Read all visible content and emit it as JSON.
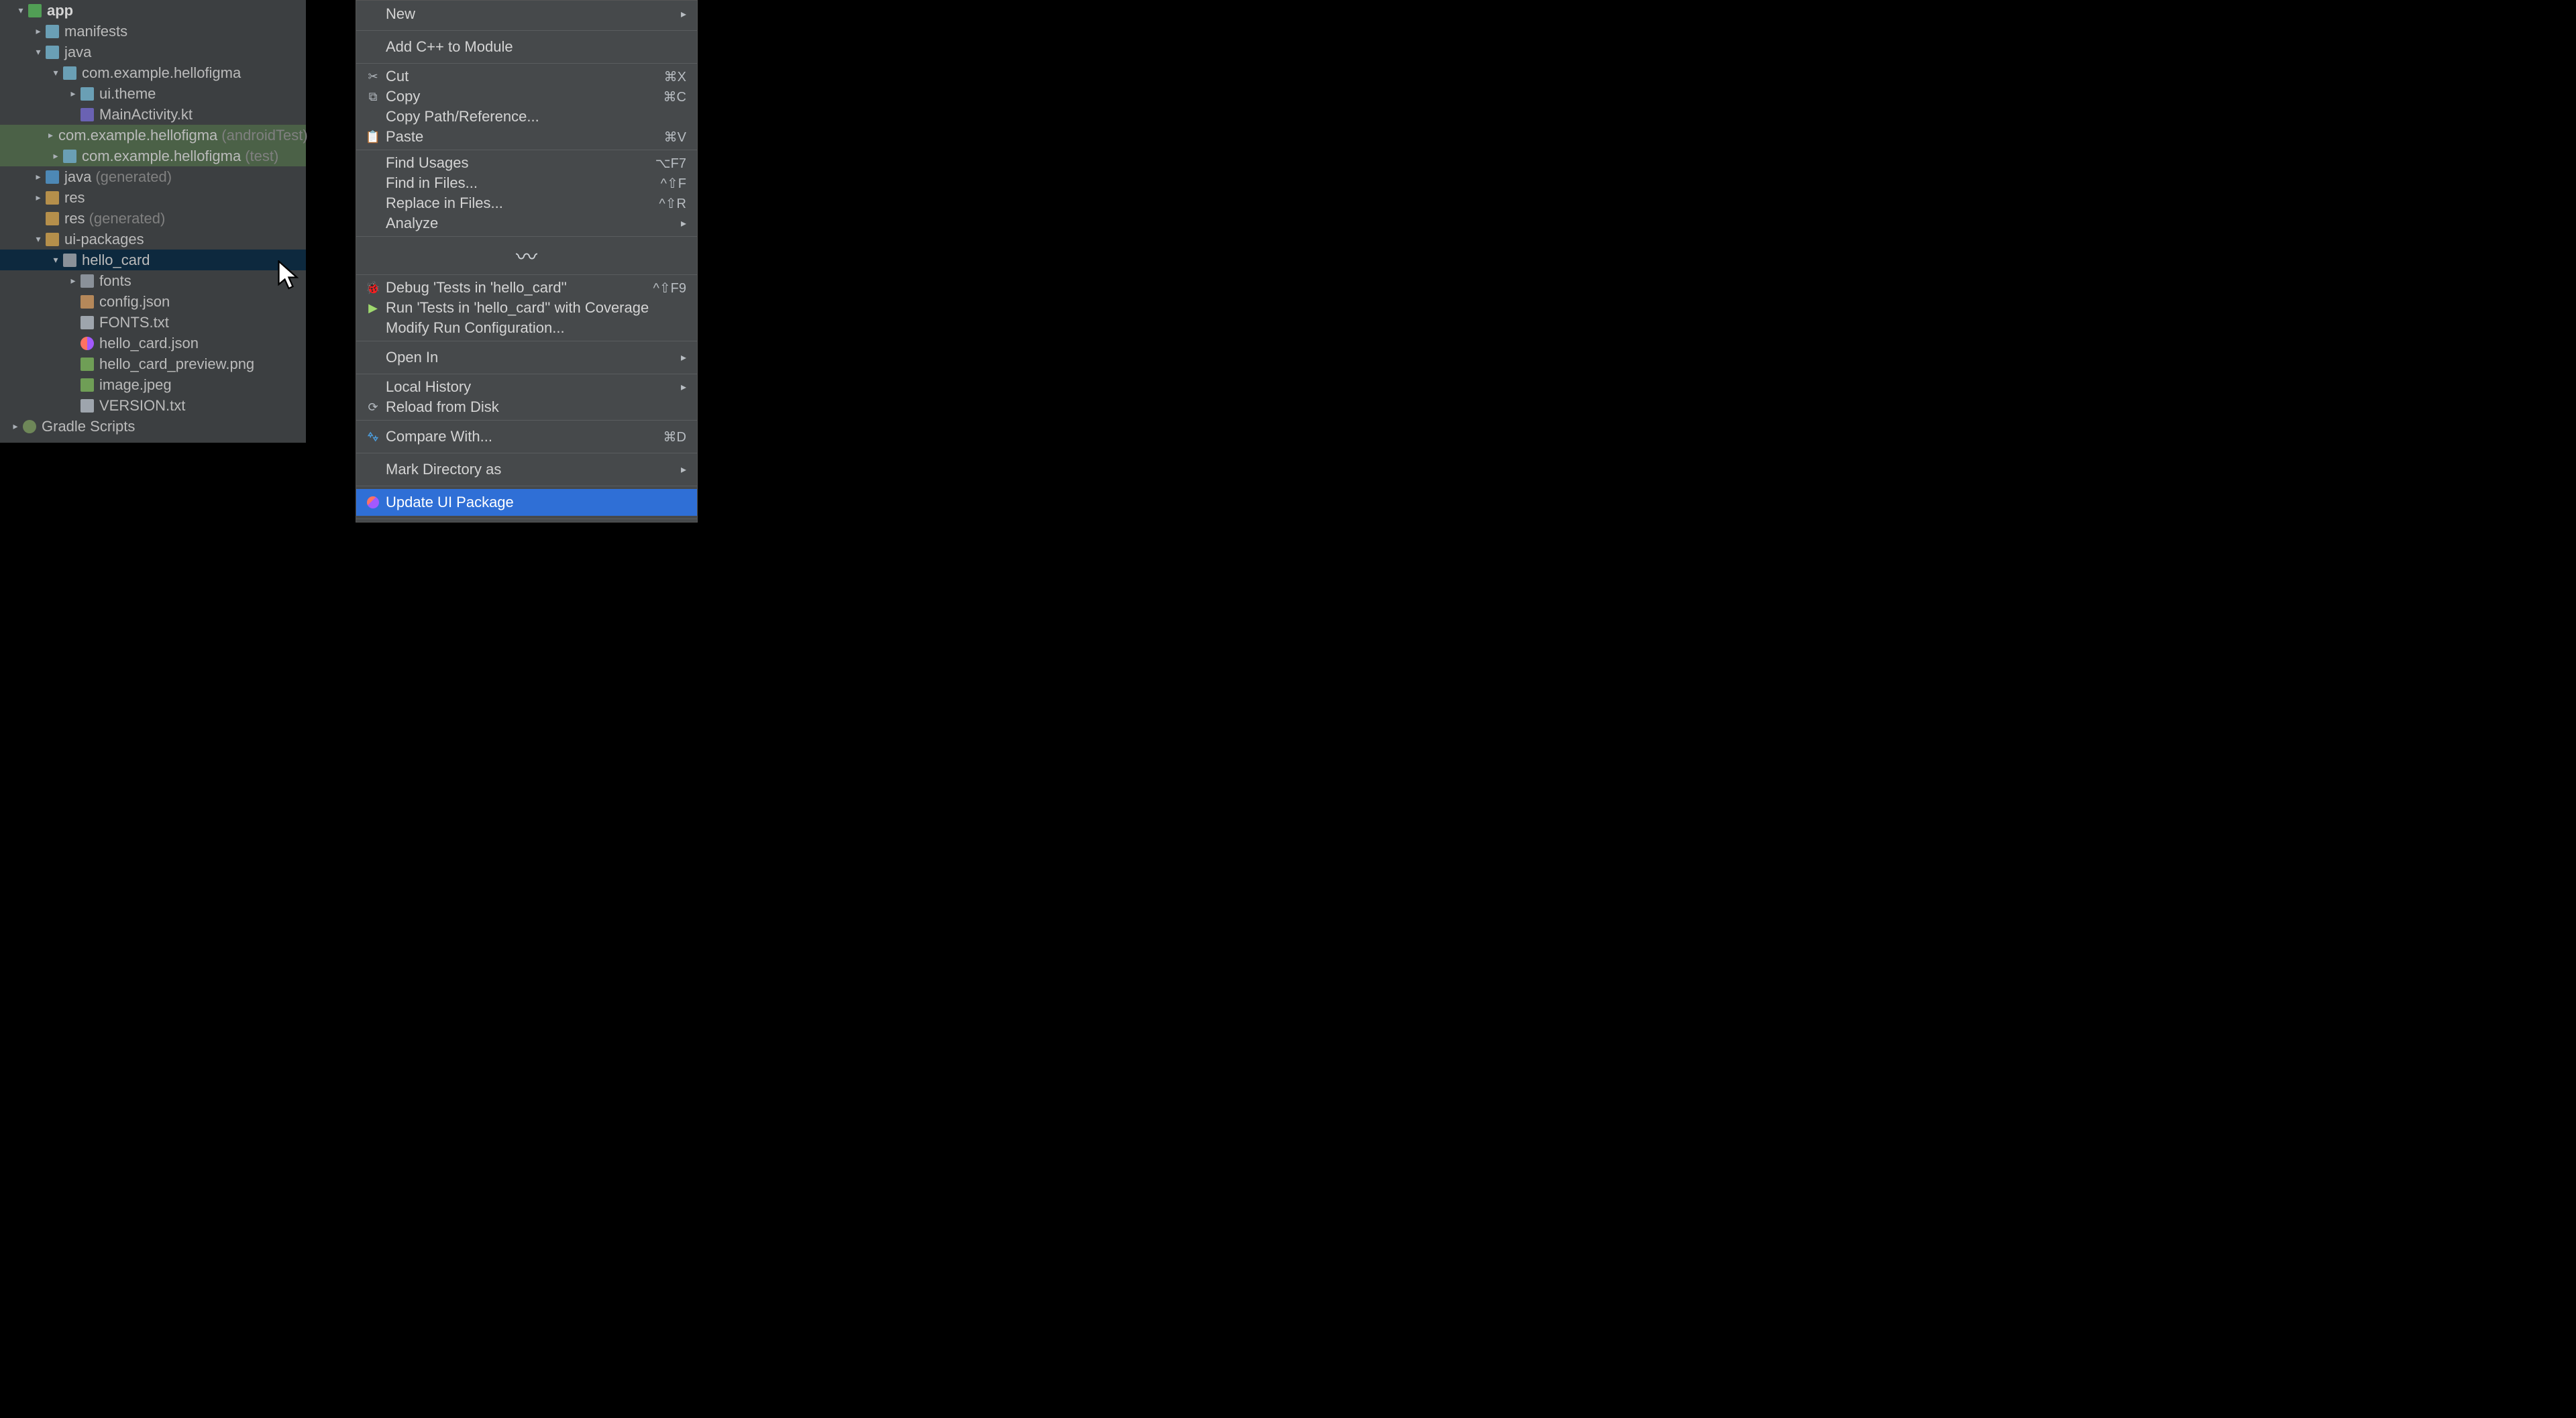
{
  "tree": {
    "root": {
      "label": "app",
      "bold": true
    },
    "manifests": {
      "label": "manifests"
    },
    "java": {
      "label": "java"
    },
    "pkg_main": {
      "label": "com.example.hellofigma"
    },
    "ui_theme": {
      "label": "ui.theme"
    },
    "main_activity": {
      "label": "MainActivity.kt"
    },
    "pkg_androidtest": {
      "label": "com.example.hellofigma",
      "suffix": "(androidTest)"
    },
    "pkg_test": {
      "label": "com.example.hellofigma",
      "suffix": "(test)"
    },
    "java_gen": {
      "label": "java",
      "suffix": "(generated)"
    },
    "res": {
      "label": "res"
    },
    "res_gen": {
      "label": "res",
      "suffix": "(generated)"
    },
    "ui_packages": {
      "label": "ui-packages"
    },
    "hello_card": {
      "label": "hello_card"
    },
    "fonts": {
      "label": "fonts"
    },
    "config_json": {
      "label": "config.json"
    },
    "fonts_txt": {
      "label": "FONTS.txt"
    },
    "hello_card_json": {
      "label": "hello_card.json"
    },
    "hello_card_preview": {
      "label": "hello_card_preview.png"
    },
    "image_jpeg": {
      "label": "image.jpeg"
    },
    "version_txt": {
      "label": "VERSION.txt"
    },
    "gradle_scripts": {
      "label": "Gradle Scripts"
    }
  },
  "menu": {
    "new": "New",
    "add_cpp": "Add C++ to Module",
    "cut": "Cut",
    "cut_sc": "⌘X",
    "copy": "Copy",
    "copy_sc": "⌘C",
    "copy_path": "Copy Path/Reference...",
    "paste": "Paste",
    "paste_sc": "⌘V",
    "find_usages": "Find Usages",
    "find_usages_sc": "⌥F7",
    "find_in_files": "Find in Files...",
    "find_in_files_sc": "^⇧F",
    "replace_in_files": "Replace in Files...",
    "replace_in_files_sc": "^⇧R",
    "analyze": "Analyze",
    "debug_tests": "Debug 'Tests in 'hello_card''",
    "debug_tests_sc": "^⇧F9",
    "run_coverage": "Run 'Tests in 'hello_card'' with Coverage",
    "modify_run": "Modify Run Configuration...",
    "open_in": "Open In",
    "local_history": "Local History",
    "reload_disk": "Reload from Disk",
    "compare_with": "Compare With...",
    "compare_with_sc": "⌘D",
    "mark_dir": "Mark Directory as",
    "update_ui": "Update UI Package"
  }
}
